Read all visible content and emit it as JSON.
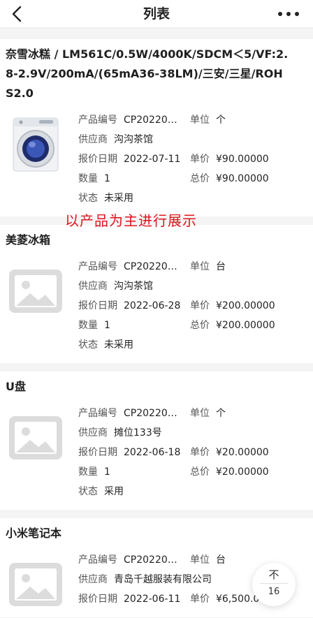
{
  "header": {
    "title": "列表"
  },
  "annotation": "以产品为主进行展示",
  "labels": {
    "code": "产品编号",
    "unit": "单位",
    "supplier": "供应商",
    "quote_date": "报价日期",
    "price": "单价",
    "qty": "数量",
    "total": "总价",
    "status": "状态"
  },
  "products": [
    {
      "title": "奈雪冰糕 / LM561C/0.5W/4000K/SDCM＜5/VF:2.8-2.9V/200mA/(65mA36-38LM)/三安/三星/ROHS2.0",
      "image": "washing-machine",
      "code": "CP20220…",
      "unit": "个",
      "supplier": "沟沟茶馆",
      "quote_date": "2022-07-11",
      "price": "¥90.00000",
      "qty": "1",
      "total": "¥90.00000",
      "status": "未采用"
    },
    {
      "title": "美菱冰箱",
      "image": "placeholder",
      "code": "CP20220…",
      "unit": "台",
      "supplier": "沟沟茶馆",
      "quote_date": "2022-06-28",
      "price": "¥200.00000",
      "qty": "1",
      "total": "¥200.00000",
      "status": "未采用"
    },
    {
      "title": "U盘",
      "image": "placeholder",
      "code": "CP20220…",
      "unit": "个",
      "supplier": "摊位133号",
      "quote_date": "2022-06-18",
      "price": "¥20.00000",
      "qty": "1",
      "total": "¥20.00000",
      "status": "采用"
    },
    {
      "title": "小米笔记本",
      "image": "placeholder",
      "code": "CP20220…",
      "unit": "台",
      "supplier": "青岛千越服装有限公司",
      "quote_date": "2022-06-11",
      "price": "¥6,500.00000",
      "qty": "",
      "total": "",
      "status": ""
    }
  ],
  "float_button": {
    "arrow": "不",
    "count": "16"
  }
}
